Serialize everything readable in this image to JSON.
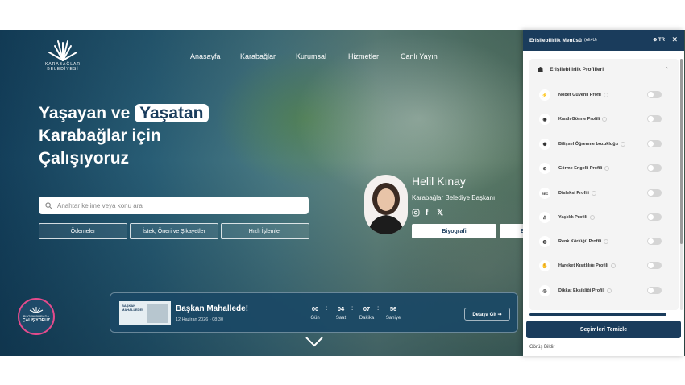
{
  "logo": {
    "text": "KARABAĞLAR BELEDİYESİ"
  },
  "nav": [
    "Anasayfa",
    "Karabağlar",
    "Kurumsal",
    "Hizmetler",
    "Canlı Yayın"
  ],
  "headline": {
    "line1_a": "Yaşayan ve",
    "line1_b": "Yaşatan",
    "line2": "Karabağlar için",
    "line3": "Çalışıyoruz"
  },
  "search": {
    "placeholder": "Anahtar kelime veya konu ara"
  },
  "quick_buttons": [
    "Ödemeler",
    "İstek, Öneri ve Şikayetler",
    "Hızlı İşlemler"
  ],
  "mayor": {
    "name": "Helil Kınay",
    "title": "Karabağlar Belediye Başkanı",
    "bio_button": "Biyografi",
    "second_button": "B"
  },
  "badge": {
    "line1": "BUGÜN BURADA",
    "line2": "ÇALIŞIYORUZ"
  },
  "event": {
    "title": "Başkan Mahallede!",
    "date": "12 Haziran 2026 - 08:30",
    "thumb_label": "BAŞKAN MAHALLEDE!",
    "countdown": [
      {
        "value": "00",
        "unit": "Gün"
      },
      {
        "value": "04",
        "unit": "Saat"
      },
      {
        "value": "07",
        "unit": "Dakika"
      },
      {
        "value": "56",
        "unit": "Saniye"
      }
    ],
    "detail_button": "Detaya Git ➔"
  },
  "a11y": {
    "title": "Erişilebilirlik Menüsü",
    "shortcut": "(Alt+U)",
    "lang": "TR",
    "section_title": "Erişilebilirlik Profilleri",
    "profiles": [
      {
        "label": "Nöbet Güvenli Profil",
        "icon": "⚡"
      },
      {
        "label": "Kısıtlı Görme Profili",
        "icon": "◉"
      },
      {
        "label": "Bilişsel Öğrenme bozukluğu",
        "icon": "✺"
      },
      {
        "label": "Görme Engelli Profili",
        "icon": "⊘"
      },
      {
        "label": "Disleksi Profili",
        "icon": "REC"
      },
      {
        "label": "Yaşlılık Profili",
        "icon": "♙"
      },
      {
        "label": "Renk Körlüğü Profili",
        "icon": "◍"
      },
      {
        "label": "Hareket Kısıtlılığı Profili",
        "icon": "✋"
      },
      {
        "label": "Dikkat Eksikliği Profili",
        "icon": "◎"
      }
    ],
    "clear_button": "Seçimleri Temizle",
    "feedback": "Görüş Bildir"
  }
}
